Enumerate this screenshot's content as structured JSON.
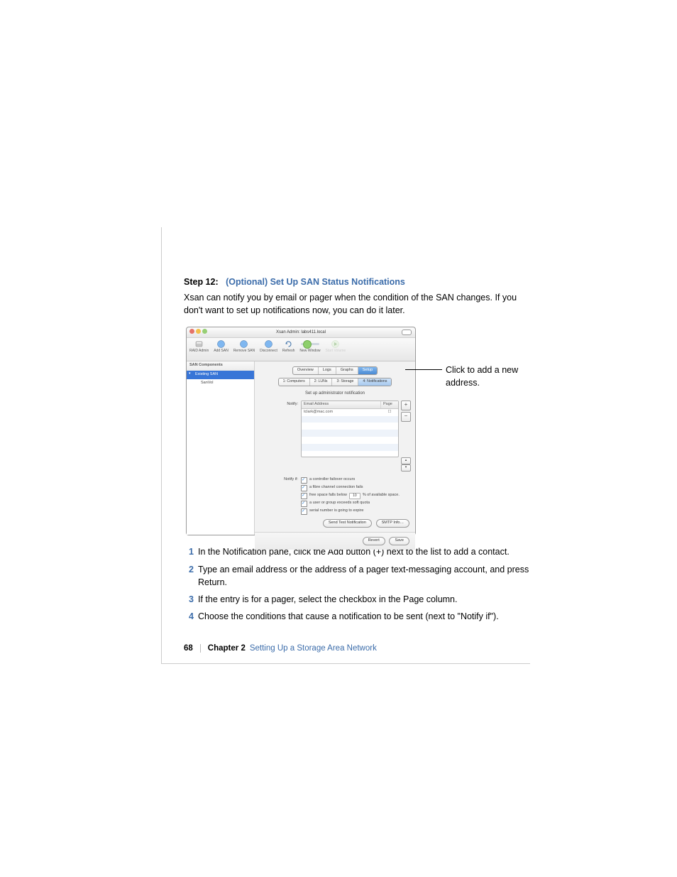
{
  "step": {
    "label": "Step 12:",
    "title": "(Optional) Set Up SAN Status Notifications"
  },
  "intro": "Xsan can notify you by email or pager when the condition of the SAN changes. If you don't want to set up notifications now, you can do it later.",
  "screenshot": {
    "window_title": "Xsan Admin: labs411.local",
    "toolbar": [
      {
        "label": "RAID Admin"
      },
      {
        "label": "Add SAN"
      },
      {
        "label": "Remove SAN"
      },
      {
        "label": "Disconnect"
      },
      {
        "label": "Refresh"
      },
      {
        "label": "New Window"
      },
      {
        "label": "Start Volume"
      }
    ],
    "sidebar": {
      "header": "SAN Components",
      "selected": "Existing SAN",
      "child": "SanVol"
    },
    "tabs1": [
      "Overview",
      "Logs",
      "Graphs",
      "Setup"
    ],
    "tabs1_active": 3,
    "tabs2": [
      "1: Computers",
      "2: LUNs",
      "3: Storage",
      "4: Notifications"
    ],
    "tabs2_active": 3,
    "heading": "Set up administrator notification",
    "notify_label": "Notify:",
    "list": {
      "col1": "Email Address",
      "col2": "Page",
      "rows": [
        {
          "addr": "tclark@mac.com",
          "page": false
        }
      ]
    },
    "add_btn": "+",
    "remove_btn": "−",
    "notify_if_label": "Notify if:",
    "conditions": [
      "a controller failover occurs",
      "a fibre channel connection fails",
      {
        "before": "free space falls below",
        "pct": "10",
        "after": "% of available space."
      },
      "a user or group exceeds soft quota",
      "serial number is going to expire"
    ],
    "buttons": {
      "send_test": "Send Test Notification",
      "smtp": "SMTP Info…",
      "revert": "Revert",
      "save": "Save"
    }
  },
  "annotation": "Click to add a new address.",
  "steps": [
    "In the Notification pane, click the Add button (+) next to the list to add a contact.",
    "Type an email address or the address of a pager text-messaging account, and press Return.",
    "If the entry is for a pager, select the checkbox in the Page column.",
    "Choose the conditions that cause a notification to be sent (next to \"Notify if\")."
  ],
  "footer": {
    "page": "68",
    "chapter": "Chapter 2",
    "title": "Setting Up a Storage Area Network"
  }
}
